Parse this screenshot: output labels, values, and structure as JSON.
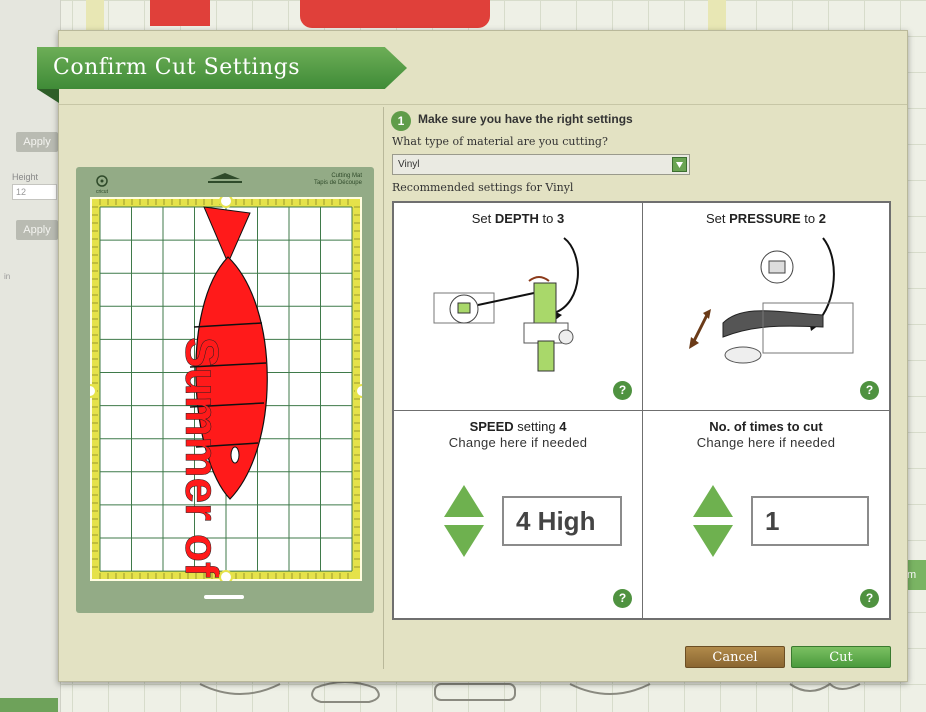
{
  "background": {
    "apply_label_1": "Apply",
    "apply_label_2": "Apply",
    "height_label": "Height",
    "height_value": "12",
    "unit_label": "in",
    "right_tab_label": "Im"
  },
  "dialog": {
    "title": "Confirm Cut Settings",
    "step_number": "1",
    "step_title": "Make sure you have the right settings",
    "material_question": "What type of material are you cutting?",
    "material_selected": "Vinyl",
    "recommended_label": "Recommended settings for Vinyl",
    "mat": {
      "logo_text": "cricut",
      "tag_line1": "Cutting Mat",
      "tag_line2": "Tapis de Découpe",
      "design_text": "Summer of Love"
    },
    "depth": {
      "prefix": "Set ",
      "label": "DEPTH",
      "mid": " to ",
      "value": "3"
    },
    "pressure": {
      "prefix": "Set ",
      "label": "PRESSURE",
      "mid": " to ",
      "value": "2"
    },
    "speed": {
      "label": "SPEED",
      "mid": " setting ",
      "value": "4",
      "sub": "Change here if needed",
      "field_value": "4 High"
    },
    "times": {
      "label": "No. of times to cut",
      "sub": "Change here if needed",
      "field_value": "1"
    },
    "help_glyph": "?",
    "cancel_label": "Cancel",
    "cut_label": "Cut"
  },
  "colors": {
    "brand_green": "#4f9240",
    "cut_red": "#ff1a1a",
    "cancel_brown": "#9a7438"
  }
}
